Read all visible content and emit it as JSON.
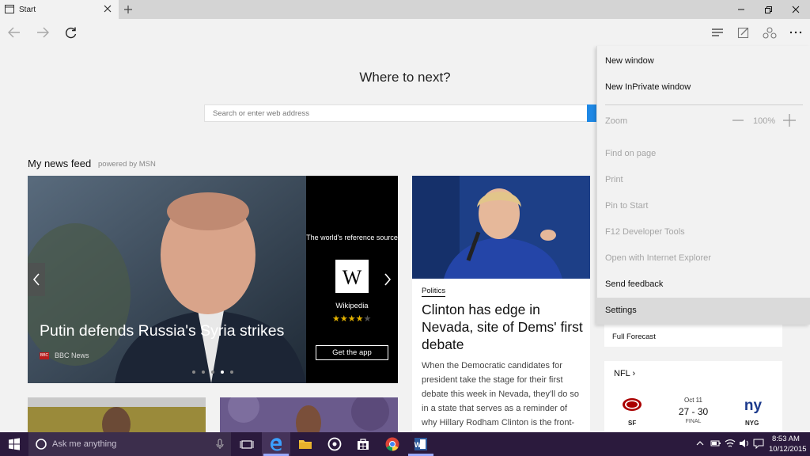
{
  "browser": {
    "tab_title": "Start",
    "tab_icon": "start-page-icon",
    "nav_icons": [
      "back-icon",
      "forward-icon",
      "refresh-icon"
    ],
    "toolbar_icons": [
      "hub-icon",
      "web-note-icon",
      "share-icon",
      "more-icon"
    ]
  },
  "start_page": {
    "heading": "Where to next?",
    "search_placeholder": "Search or enter web address",
    "feed_title": "My news feed",
    "feed_powered": "powered by MSN"
  },
  "hero": {
    "headline": "Putin defends Russia's Syria strikes",
    "source": "BBC News",
    "source_logo": "BBC",
    "ad": {
      "tagline": "The world's reference source",
      "logo_letter": "W",
      "name": "Wikipedia",
      "rating": 4,
      "rating_max": 5,
      "cta": "Get the app"
    },
    "slide_count": 5,
    "active_slide": 4
  },
  "article": {
    "category": "Politics",
    "headline": "Clinton has edge in Nevada, site of Dems' first debate",
    "body": "When the Democratic candidates for president take the stage for their first debate this week in Nevada, they'll do so in a state that serves as a reminder of why Hillary Rodham Clinton is the front-"
  },
  "widgets": {
    "forecast_link": "Full Forecast",
    "nfl": {
      "title": "NFL",
      "date": "Oct 11",
      "score": "27 - 30",
      "status": "FINAL",
      "team1": "SF",
      "team2": "NYG",
      "team2_logo": "ny"
    }
  },
  "menu": {
    "new_window": "New window",
    "new_inprivate": "New InPrivate window",
    "zoom_label": "Zoom",
    "zoom_value": "100%",
    "find": "Find on page",
    "print": "Print",
    "pin": "Pin to Start",
    "devtools": "F12 Developer Tools",
    "open_ie": "Open with Internet Explorer",
    "feedback": "Send feedback",
    "settings": "Settings"
  },
  "taskbar": {
    "search_placeholder": "Ask me anything",
    "time": "8:53 AM",
    "date": "10/12/2015",
    "apps": [
      "task-view-icon",
      "edge-icon",
      "file-explorer-icon",
      "groove-icon",
      "store-icon",
      "chrome-icon",
      "word-icon"
    ]
  },
  "colors": {
    "accent": "#1e88e5",
    "taskbar": "#2b1a3d",
    "menu_bg": "#f2f2f2",
    "disabled_text": "#a5a5a5"
  }
}
